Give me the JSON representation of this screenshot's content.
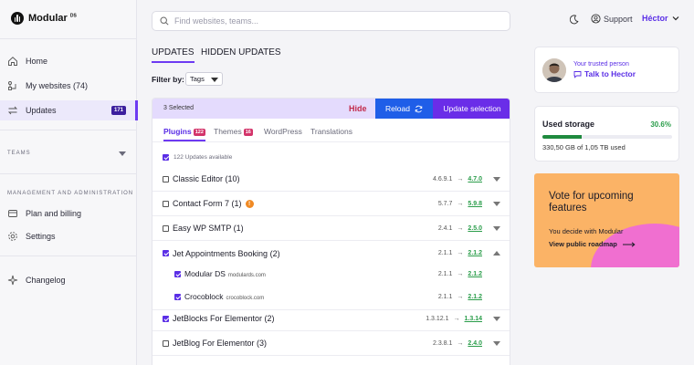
{
  "brand": {
    "name": "Modular",
    "suffix": "DS"
  },
  "sidebar": {
    "nav": [
      {
        "label": "Home",
        "icon": "home-icon"
      },
      {
        "label": "My websites (74)",
        "icon": "websites-icon"
      },
      {
        "label": "Updates",
        "icon": "updates-icon",
        "badge": "171",
        "active": true
      }
    ],
    "teams_label": "TEAMS",
    "management_label": "MANAGEMENT AND ADMINISTRATION",
    "management_items": [
      {
        "label": "Plan and billing",
        "icon": "billing-icon"
      },
      {
        "label": "Settings",
        "icon": "gear-icon"
      }
    ],
    "changelog_label": "Changelog"
  },
  "header": {
    "search_placeholder": "Find websites, teams...",
    "support_label": "Support",
    "user_name": "Héctor"
  },
  "tabs": {
    "updates": "UPDATES",
    "hidden": "HIDDEN UPDATES"
  },
  "filter": {
    "label": "Filter by:",
    "value": "Tags"
  },
  "action_bar": {
    "selected": "3 Selected",
    "hide": "Hide",
    "reload": "Reload",
    "update_selection": "Update selection"
  },
  "sub_tabs": [
    {
      "label": "Plugins",
      "count": "122",
      "active": true
    },
    {
      "label": "Themes",
      "count": "16"
    },
    {
      "label": "WordPress"
    },
    {
      "label": "Translations"
    }
  ],
  "available_label": "122 Updates available",
  "rows": [
    {
      "name": "Classic Editor (10)",
      "from": "4.6.9.1",
      "to": "4.7.0",
      "checked": false
    },
    {
      "name": "Contact Form 7 (1)",
      "from": "5.7.7",
      "to": "5.9.8",
      "checked": false,
      "warning": "!"
    },
    {
      "name": "Easy WP SMTP (1)",
      "from": "2.4.1",
      "to": "2.5.0",
      "checked": false
    },
    {
      "name": "Jet Appointments Booking (2)",
      "from": "2.1.1",
      "to": "2.1.2",
      "checked": true,
      "expanded": true
    },
    {
      "name": "Modular DS",
      "domain": "modulards.com",
      "from": "2.1.1",
      "to": "2.1.2",
      "checked": true,
      "child": true
    },
    {
      "name": "Crocoblock",
      "domain": "crocoblock.com",
      "from": "2.1.1",
      "to": "2.1.2",
      "checked": true,
      "child": true
    },
    {
      "name": "JetBlocks For Elementor (2)",
      "from": "1.3.12.1",
      "to": "1.3.14",
      "checked": true
    },
    {
      "name": "JetBlog For Elementor (3)",
      "from": "2.3.8.1",
      "to": "2.4.0",
      "checked": false
    }
  ],
  "trusted": {
    "label": "Your trusted person",
    "link": "Talk to Hector"
  },
  "storage": {
    "title": "Used storage",
    "percent_text": "30.6%",
    "percent": 30.6,
    "detail": "330,50 GB of 1,05 TB used"
  },
  "vote": {
    "title": "Vote for upcoming features",
    "subtitle": "You decide with Modular",
    "link": "View public roadmap"
  },
  "colors": {
    "accent": "#6d3af2",
    "reload": "#1f5ee8",
    "update": "#6a2de8",
    "success": "#2a9d4a",
    "promo": "#fbb366",
    "promo_blob": "#f06fd0"
  }
}
